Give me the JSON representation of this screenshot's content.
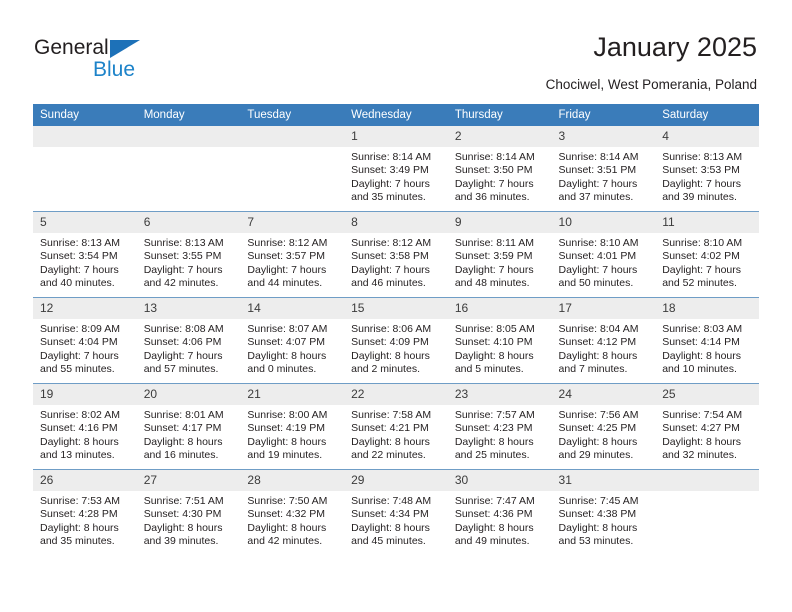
{
  "brand": {
    "name_top": "General",
    "name_bottom": "Blue"
  },
  "header": {
    "title": "January 2025",
    "location": "Chociwel, West Pomerania, Poland"
  },
  "colors": {
    "header_blue": "#3a7cba",
    "brand_blue": "#1d83c9",
    "daynum_band": "#ededed",
    "row_rule": "#6f9dc6"
  },
  "weekdays": [
    "Sunday",
    "Monday",
    "Tuesday",
    "Wednesday",
    "Thursday",
    "Friday",
    "Saturday"
  ],
  "labels": {
    "sunrise": "Sunrise:",
    "sunset": "Sunset:",
    "daylight": "Daylight:"
  },
  "weeks": [
    [
      {
        "day": "",
        "empty": true
      },
      {
        "day": "",
        "empty": true
      },
      {
        "day": "",
        "empty": true
      },
      {
        "day": "1",
        "sunrise": "Sunrise: 8:14 AM",
        "sunset": "Sunset: 3:49 PM",
        "daylight": "Daylight: 7 hours and 35 minutes."
      },
      {
        "day": "2",
        "sunrise": "Sunrise: 8:14 AM",
        "sunset": "Sunset: 3:50 PM",
        "daylight": "Daylight: 7 hours and 36 minutes."
      },
      {
        "day": "3",
        "sunrise": "Sunrise: 8:14 AM",
        "sunset": "Sunset: 3:51 PM",
        "daylight": "Daylight: 7 hours and 37 minutes."
      },
      {
        "day": "4",
        "sunrise": "Sunrise: 8:13 AM",
        "sunset": "Sunset: 3:53 PM",
        "daylight": "Daylight: 7 hours and 39 minutes."
      }
    ],
    [
      {
        "day": "5",
        "sunrise": "Sunrise: 8:13 AM",
        "sunset": "Sunset: 3:54 PM",
        "daylight": "Daylight: 7 hours and 40 minutes."
      },
      {
        "day": "6",
        "sunrise": "Sunrise: 8:13 AM",
        "sunset": "Sunset: 3:55 PM",
        "daylight": "Daylight: 7 hours and 42 minutes."
      },
      {
        "day": "7",
        "sunrise": "Sunrise: 8:12 AM",
        "sunset": "Sunset: 3:57 PM",
        "daylight": "Daylight: 7 hours and 44 minutes."
      },
      {
        "day": "8",
        "sunrise": "Sunrise: 8:12 AM",
        "sunset": "Sunset: 3:58 PM",
        "daylight": "Daylight: 7 hours and 46 minutes."
      },
      {
        "day": "9",
        "sunrise": "Sunrise: 8:11 AM",
        "sunset": "Sunset: 3:59 PM",
        "daylight": "Daylight: 7 hours and 48 minutes."
      },
      {
        "day": "10",
        "sunrise": "Sunrise: 8:10 AM",
        "sunset": "Sunset: 4:01 PM",
        "daylight": "Daylight: 7 hours and 50 minutes."
      },
      {
        "day": "11",
        "sunrise": "Sunrise: 8:10 AM",
        "sunset": "Sunset: 4:02 PM",
        "daylight": "Daylight: 7 hours and 52 minutes."
      }
    ],
    [
      {
        "day": "12",
        "sunrise": "Sunrise: 8:09 AM",
        "sunset": "Sunset: 4:04 PM",
        "daylight": "Daylight: 7 hours and 55 minutes."
      },
      {
        "day": "13",
        "sunrise": "Sunrise: 8:08 AM",
        "sunset": "Sunset: 4:06 PM",
        "daylight": "Daylight: 7 hours and 57 minutes."
      },
      {
        "day": "14",
        "sunrise": "Sunrise: 8:07 AM",
        "sunset": "Sunset: 4:07 PM",
        "daylight": "Daylight: 8 hours and 0 minutes."
      },
      {
        "day": "15",
        "sunrise": "Sunrise: 8:06 AM",
        "sunset": "Sunset: 4:09 PM",
        "daylight": "Daylight: 8 hours and 2 minutes."
      },
      {
        "day": "16",
        "sunrise": "Sunrise: 8:05 AM",
        "sunset": "Sunset: 4:10 PM",
        "daylight": "Daylight: 8 hours and 5 minutes."
      },
      {
        "day": "17",
        "sunrise": "Sunrise: 8:04 AM",
        "sunset": "Sunset: 4:12 PM",
        "daylight": "Daylight: 8 hours and 7 minutes."
      },
      {
        "day": "18",
        "sunrise": "Sunrise: 8:03 AM",
        "sunset": "Sunset: 4:14 PM",
        "daylight": "Daylight: 8 hours and 10 minutes."
      }
    ],
    [
      {
        "day": "19",
        "sunrise": "Sunrise: 8:02 AM",
        "sunset": "Sunset: 4:16 PM",
        "daylight": "Daylight: 8 hours and 13 minutes."
      },
      {
        "day": "20",
        "sunrise": "Sunrise: 8:01 AM",
        "sunset": "Sunset: 4:17 PM",
        "daylight": "Daylight: 8 hours and 16 minutes."
      },
      {
        "day": "21",
        "sunrise": "Sunrise: 8:00 AM",
        "sunset": "Sunset: 4:19 PM",
        "daylight": "Daylight: 8 hours and 19 minutes."
      },
      {
        "day": "22",
        "sunrise": "Sunrise: 7:58 AM",
        "sunset": "Sunset: 4:21 PM",
        "daylight": "Daylight: 8 hours and 22 minutes."
      },
      {
        "day": "23",
        "sunrise": "Sunrise: 7:57 AM",
        "sunset": "Sunset: 4:23 PM",
        "daylight": "Daylight: 8 hours and 25 minutes."
      },
      {
        "day": "24",
        "sunrise": "Sunrise: 7:56 AM",
        "sunset": "Sunset: 4:25 PM",
        "daylight": "Daylight: 8 hours and 29 minutes."
      },
      {
        "day": "25",
        "sunrise": "Sunrise: 7:54 AM",
        "sunset": "Sunset: 4:27 PM",
        "daylight": "Daylight: 8 hours and 32 minutes."
      }
    ],
    [
      {
        "day": "26",
        "sunrise": "Sunrise: 7:53 AM",
        "sunset": "Sunset: 4:28 PM",
        "daylight": "Daylight: 8 hours and 35 minutes."
      },
      {
        "day": "27",
        "sunrise": "Sunrise: 7:51 AM",
        "sunset": "Sunset: 4:30 PM",
        "daylight": "Daylight: 8 hours and 39 minutes."
      },
      {
        "day": "28",
        "sunrise": "Sunrise: 7:50 AM",
        "sunset": "Sunset: 4:32 PM",
        "daylight": "Daylight: 8 hours and 42 minutes."
      },
      {
        "day": "29",
        "sunrise": "Sunrise: 7:48 AM",
        "sunset": "Sunset: 4:34 PM",
        "daylight": "Daylight: 8 hours and 45 minutes."
      },
      {
        "day": "30",
        "sunrise": "Sunrise: 7:47 AM",
        "sunset": "Sunset: 4:36 PM",
        "daylight": "Daylight: 8 hours and 49 minutes."
      },
      {
        "day": "31",
        "sunrise": "Sunrise: 7:45 AM",
        "sunset": "Sunset: 4:38 PM",
        "daylight": "Daylight: 8 hours and 53 minutes."
      },
      {
        "day": "",
        "empty": true
      }
    ]
  ]
}
